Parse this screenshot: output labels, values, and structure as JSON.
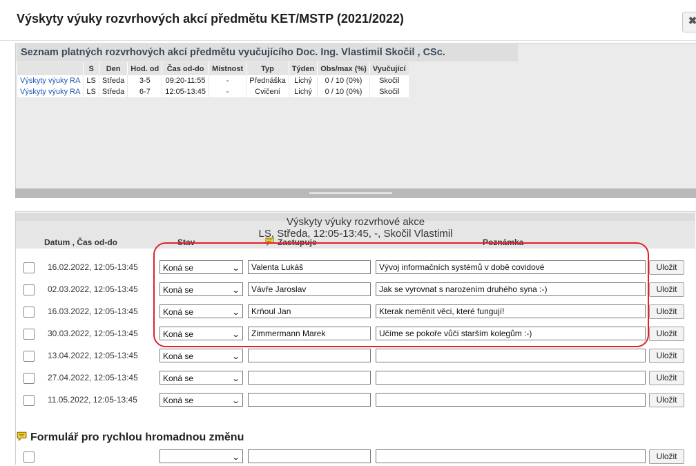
{
  "dialog": {
    "title": "Výskyty výuky rozvrhových akcí předmětu KET/MSTP (2021/2022)",
    "close_label": "✖"
  },
  "akce": {
    "title": "Seznam platných rozvrhových akcí předmětu vyučujícího Doc. Ing. Vlastimil Skočil , CSc.",
    "headers": [
      "",
      "S",
      "Den",
      "Hod. od",
      "Čas od-do",
      "Místnost",
      "Typ",
      "Týden",
      "Obs/max (%)",
      "Vyučující"
    ],
    "rows": [
      [
        "Výskyty výuky RA",
        "LS",
        "Středa",
        "3-5",
        "09:20-11:55",
        "-",
        "Přednáška",
        "Lichý",
        "0 / 10 (0%)",
        "Skočil"
      ],
      [
        "Výskyty výuky RA",
        "LS",
        "Středa",
        "6-7",
        "12:05-13:45",
        "-",
        "Cvičení",
        "Lichý",
        "0 / 10 (0%)",
        "Skočil"
      ]
    ]
  },
  "vyskyty": {
    "title": "Výskyty výuky rozvrhové akce",
    "subtitle": "LS, Středa, 12:05-13:45, -, Skočil Vlastimil",
    "headers": {
      "datum": "Datum , Čas od-do",
      "stav": "Stav",
      "zastupuje": "Zastupuje",
      "poznamka": "Poznámka"
    },
    "save_label": "Uložit",
    "rows": [
      {
        "date": "16.02.2022, 12:05-13:45",
        "stav": "Koná se",
        "zastupuje": "Valenta Lukáš",
        "poznamka": "Vývoj informačních systémů v době covidové"
      },
      {
        "date": "02.03.2022, 12:05-13:45",
        "stav": "Koná se",
        "zastupuje": "Vávře Jaroslav",
        "poznamka": "Jak se vyrovnat s narozením druhého syna :-)"
      },
      {
        "date": "16.03.2022, 12:05-13:45",
        "stav": "Koná se",
        "zastupuje": "Krňoul Jan",
        "poznamka": "Kterak neměnit věci, které fungují!"
      },
      {
        "date": "30.03.2022, 12:05-13:45",
        "stav": "Koná se",
        "zastupuje": "Zimmermann Marek",
        "poznamka": "Učíme se pokoře vůči starším kolegům :-)"
      },
      {
        "date": "13.04.2022, 12:05-13:45",
        "stav": "Koná se",
        "zastupuje": "",
        "poznamka": ""
      },
      {
        "date": "27.04.2022, 12:05-13:45",
        "stav": "Koná se",
        "zastupuje": "",
        "poznamka": ""
      },
      {
        "date": "11.05.2022, 12:05-13:45",
        "stav": "Koná se",
        "zastupuje": "",
        "poznamka": ""
      }
    ]
  },
  "quick_form": {
    "title": "Formulář pro rychlou hromadnou změnu",
    "stav": "",
    "zastupuje": "",
    "poznamka": "",
    "save_label": "Uložit"
  },
  "colors": {
    "link": "#1a56b0",
    "highlight": "#e0202a",
    "splitter": "#b9b9b9"
  },
  "icons": [
    "close-icon",
    "comment-icon",
    "chevron-down-icon",
    "checkbox-icon"
  ]
}
